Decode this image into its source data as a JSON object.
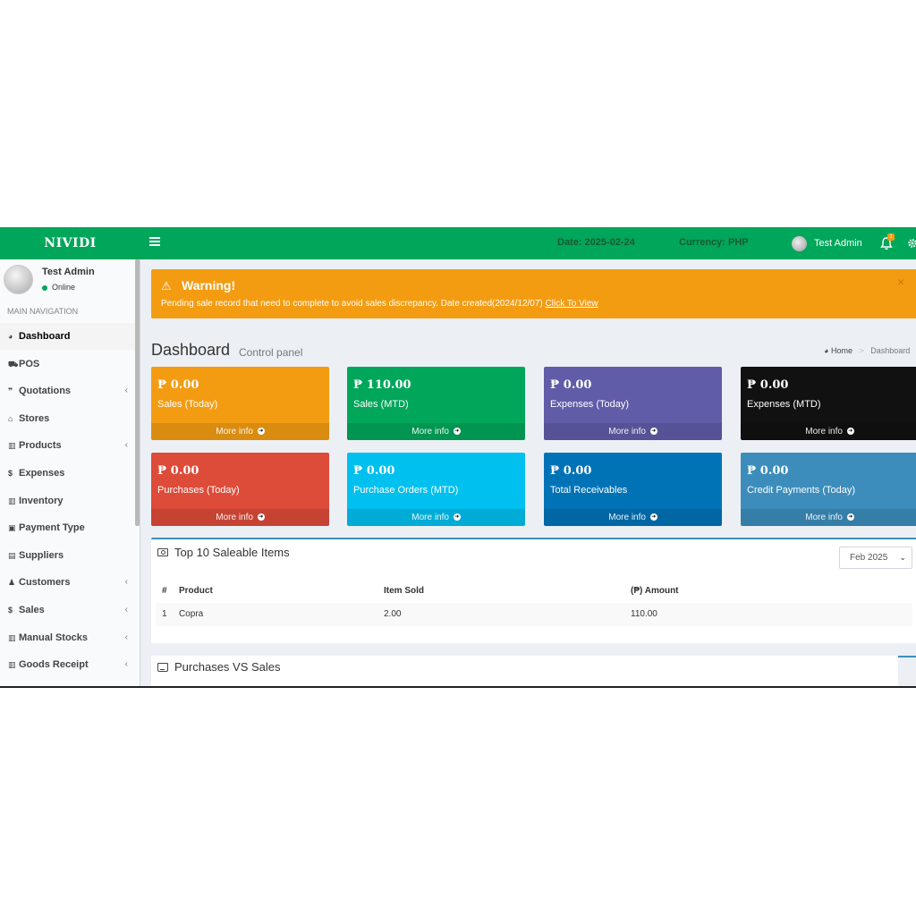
{
  "topbar": {
    "brand": "NIVIDI",
    "date": "Date: 2025-02-24",
    "currency": "Currency: PHP",
    "user": "Test Admin",
    "notifications": "1",
    "color": "#00a65a"
  },
  "sidebar": {
    "user_name": "Test Admin",
    "status": "Online",
    "header": "MAIN NAVIGATION",
    "items": [
      {
        "label": "Dashboard",
        "icon": "dashboard-icon",
        "glyph": "◕",
        "has_children": false,
        "active": true
      },
      {
        "label": "POS",
        "icon": "cart-icon",
        "glyph": "⛟",
        "has_children": false,
        "active": false
      },
      {
        "label": "Quotations",
        "icon": "quote-icon",
        "glyph": "❞",
        "has_children": true,
        "active": false
      },
      {
        "label": "Stores",
        "icon": "home-icon",
        "glyph": "⌂",
        "has_children": false,
        "active": false
      },
      {
        "label": "Products",
        "icon": "barcode-icon",
        "glyph": "▥",
        "has_children": true,
        "active": false
      },
      {
        "label": "Expenses",
        "icon": "dollar-icon",
        "glyph": "$",
        "has_children": false,
        "active": false
      },
      {
        "label": "Inventory",
        "icon": "barcode-icon",
        "glyph": "▥",
        "has_children": false,
        "active": false
      },
      {
        "label": "Payment Type",
        "icon": "money-icon",
        "glyph": "▣",
        "has_children": false,
        "active": false
      },
      {
        "label": "Suppliers",
        "icon": "building-icon",
        "glyph": "▤",
        "has_children": false,
        "active": false
      },
      {
        "label": "Customers",
        "icon": "user-plus-icon",
        "glyph": "♟",
        "has_children": true,
        "active": false
      },
      {
        "label": "Sales",
        "icon": "dollar-icon",
        "glyph": "$",
        "has_children": true,
        "active": false
      },
      {
        "label": "Manual Stocks",
        "icon": "barcode-icon",
        "glyph": "▥",
        "has_children": true,
        "active": false
      },
      {
        "label": "Goods Receipt",
        "icon": "barcode-icon",
        "glyph": "▥",
        "has_children": true,
        "active": false
      }
    ]
  },
  "alert": {
    "title": "Warning!",
    "message": "Pending sale record that need to complete to avoid sales discrepancy. Date created(2024/12/07)",
    "link": "Click To View",
    "close": "×"
  },
  "page": {
    "title": "Dashboard",
    "subtitle": "Control panel",
    "breadcrumb_home": "Home",
    "breadcrumb_current": "Dashboard"
  },
  "boxes": [
    {
      "value": "₱ 0.00",
      "label": "Sales (Today)",
      "more": "More info",
      "color": "#f39c12"
    },
    {
      "value": "₱ 110.00",
      "label": "Sales (MTD)",
      "more": "More info",
      "color": "#00a65a"
    },
    {
      "value": "₱ 0.00",
      "label": "Expenses (Today)",
      "more": "More info",
      "color": "#605ca8"
    },
    {
      "value": "₱ 0.00",
      "label": "Expenses (MTD)",
      "more": "More info",
      "color": "#111111"
    },
    {
      "value": "₱ 0.00",
      "label": "Purchases (Today)",
      "more": "More info",
      "color": "#dd4b39"
    },
    {
      "value": "₱ 0.00",
      "label": "Purchase Orders (MTD)",
      "more": "More info",
      "color": "#00c0ef"
    },
    {
      "value": "₱ 0.00",
      "label": "Total Receivables",
      "more": "More info",
      "color": "#0073b7"
    },
    {
      "value": "₱ 0.00",
      "label": "Credit Payments (Today)",
      "more": "More info",
      "color": "#3c8dbc"
    }
  ],
  "top_items": {
    "title": "Top 10 Saleable Items",
    "period": "Feb 2025",
    "headers": [
      "#",
      "Product",
      "Item Sold",
      "(₱) Amount"
    ],
    "rows": [
      [
        "1",
        "Copra",
        "2.00",
        "110.00"
      ]
    ]
  },
  "purchases_vs_sales": {
    "title": "Purchases VS Sales"
  }
}
